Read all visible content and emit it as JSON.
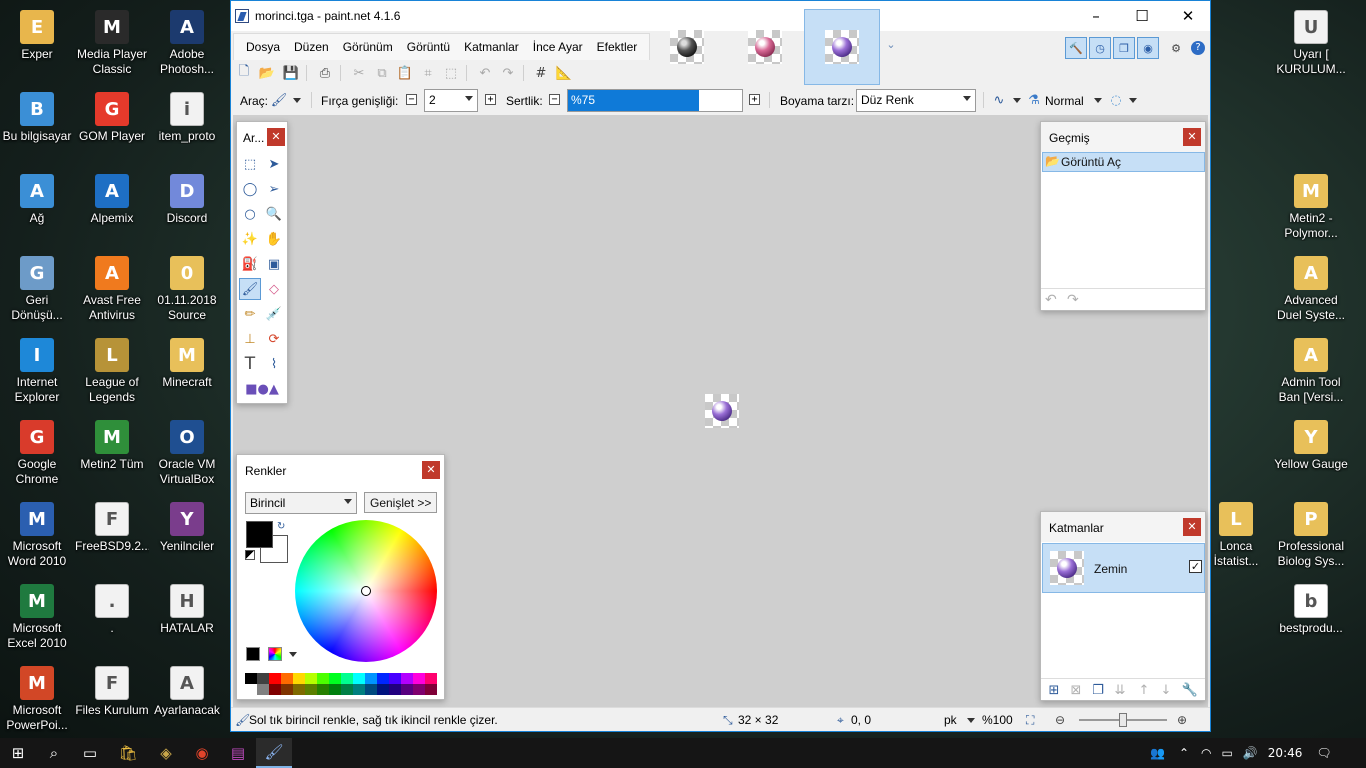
{
  "desktop": {
    "left_icons": [
      {
        "label": "Exper",
        "icon": "user-folder-icon",
        "color": "#e8b64c"
      },
      {
        "label": "Media Player Classic",
        "icon": "media-player-icon",
        "color": "#2a2a2a"
      },
      {
        "label": "Adobe Photosh...",
        "icon": "photoshop-icon",
        "color": "#1c3a6e"
      },
      {
        "label": "Bu bilgisayar",
        "icon": "computer-icon",
        "color": "#3b8fd6"
      },
      {
        "label": "GOM Player",
        "icon": "gom-player-icon",
        "color": "#e53a2b"
      },
      {
        "label": "item_proto",
        "icon": "text-file-icon",
        "color": "#f2f2f2"
      },
      {
        "label": "Ağ",
        "icon": "network-icon",
        "color": "#3b8fd6"
      },
      {
        "label": "Alpemix",
        "icon": "alpemix-icon",
        "color": "#1e6fc4"
      },
      {
        "label": "Discord",
        "icon": "discord-icon",
        "color": "#7289da"
      },
      {
        "label": "Geri Dönüşü...",
        "icon": "recycle-bin-icon",
        "color": "#6d9bc8"
      },
      {
        "label": "Avast Free Antivirus",
        "icon": "avast-icon",
        "color": "#f07a1e"
      },
      {
        "label": "01.11.2018 Source",
        "icon": "folder-icon",
        "color": "#e8c05a"
      },
      {
        "label": "Internet Explorer",
        "icon": "internet-explorer-icon",
        "color": "#1e88d8"
      },
      {
        "label": "League of Legends",
        "icon": "league-of-legends-icon",
        "color": "#b79338"
      },
      {
        "label": "Minecraft",
        "icon": "folder-icon",
        "color": "#e8c05a"
      },
      {
        "label": "Google Chrome",
        "icon": "chrome-icon",
        "color": "#d93b2b"
      },
      {
        "label": "Metin2 Tüm",
        "icon": "metin2-icon",
        "color": "#2f8f3a"
      },
      {
        "label": "Oracle VM VirtualBox",
        "icon": "virtualbox-icon",
        "color": "#1f4f91"
      },
      {
        "label": "Microsoft Word 2010",
        "icon": "word-icon",
        "color": "#2b5fb0"
      },
      {
        "label": "FreeBSD9.2....",
        "icon": "text-file-icon",
        "color": "#f2f2f2"
      },
      {
        "label": "Yenilnciler",
        "icon": "winrar-icon",
        "color": "#7a3d8c"
      },
      {
        "label": "Microsoft Excel 2010",
        "icon": "excel-icon",
        "color": "#1f7a3f"
      },
      {
        "label": ".",
        "icon": "text-file-icon",
        "color": "#f2f2f2"
      },
      {
        "label": "HATALAR",
        "icon": "text-file-icon",
        "color": "#f2f2f2"
      },
      {
        "label": "Microsoft PowerPoi...",
        "icon": "powerpoint-icon",
        "color": "#d24726"
      },
      {
        "label": "Files Kurulum",
        "icon": "text-file-icon",
        "color": "#f2f2f2"
      },
      {
        "label": "Ayarlanacak",
        "icon": "text-file-icon",
        "color": "#f2f2f2"
      }
    ],
    "right_icons": [
      {
        "label": "Uyarı [ KURULUM...",
        "icon": "text-file-icon",
        "color": "#f2f2f2"
      },
      {
        "label": "Metin2 - Polymor...",
        "icon": "folder-icon",
        "color": "#e8c05a"
      },
      {
        "label": "Advanced Duel Syste...",
        "icon": "folder-icon",
        "color": "#e8c05a"
      },
      {
        "label": "Admin Tool Ban [Versi...",
        "icon": "folder-icon",
        "color": "#e8c05a"
      },
      {
        "label": "Yellow Gauge",
        "icon": "folder-icon",
        "color": "#e8c05a"
      },
      {
        "label": "Lonca İstatist...",
        "icon": "folder-icon",
        "color": "#e8c05a"
      },
      {
        "label": "Professional Biolog Sys...",
        "icon": "folder-icon",
        "color": "#e8c05a"
      },
      {
        "label": "bestprodu...",
        "icon": "bestproducts-icon",
        "color": "#ffffff"
      }
    ]
  },
  "window": {
    "title": "morinci.tga - paint.net 4.1.6",
    "menu": [
      "Dosya",
      "Düzen",
      "Görünüm",
      "Görüntü",
      "Katmanlar",
      "İnce Ayar",
      "Efektler"
    ],
    "options": {
      "tool_label": "Araç:",
      "brush_width_label": "Fırça genişliği:",
      "brush_width_value": "2",
      "hardness_label": "Sertlik:",
      "hardness_value": "%75",
      "hardness_fraction": 0.75,
      "fill_style_label": "Boyama tarzı:",
      "fill_style_value": "Düz Renk",
      "blend_mode": "Normal"
    },
    "status": {
      "hint": "Sol tık birincil renkle, sağ tık ikincil renkle çizer.",
      "image_size": "32 × 32",
      "cursor_pos": "0, 0",
      "unit": "pk",
      "zoom": "%100"
    }
  },
  "panels": {
    "tools_title": "Ar...",
    "history": {
      "title": "Geçmiş",
      "items": [
        "Görüntü Aç"
      ]
    },
    "colors": {
      "title": "Renkler",
      "selector": "Birincil",
      "expand": "Genişlet >>"
    },
    "layers": {
      "title": "Katmanlar",
      "items": [
        "Zemin"
      ]
    }
  },
  "palette": [
    "#000000",
    "#404040",
    "#ff0000",
    "#ff6a00",
    "#ffd800",
    "#b6ff00",
    "#4cff00",
    "#00ff21",
    "#00ff90",
    "#00ffff",
    "#0094ff",
    "#0026ff",
    "#4800ff",
    "#b200ff",
    "#ff00dc",
    "#ff006e"
  ],
  "palette_dark": [
    "#ffffff",
    "#808080",
    "#7f0000",
    "#7f3300",
    "#7f6a00",
    "#5b7f00",
    "#267f00",
    "#007f0e",
    "#007f46",
    "#007f7f",
    "#004a7f",
    "#00137f",
    "#21007f",
    "#57007f",
    "#7f006e",
    "#7f0037"
  ],
  "taskbar": {
    "time": "20:46"
  }
}
